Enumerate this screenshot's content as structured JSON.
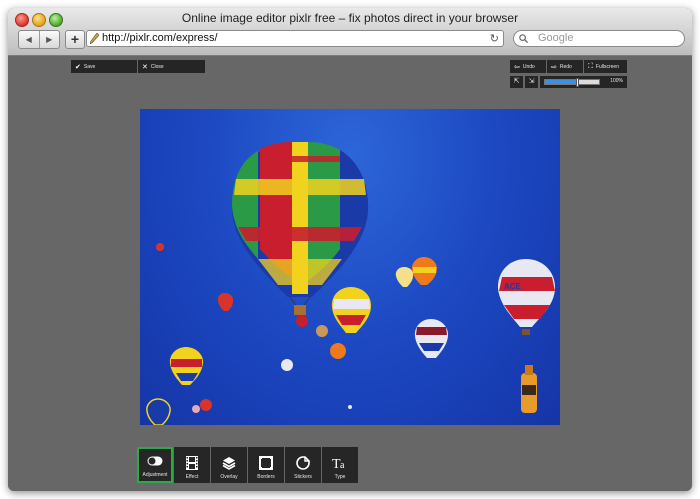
{
  "window": {
    "title": "Online image editor pixlr free – fix photos direct in your browser"
  },
  "browser": {
    "back_icon": "back-arrow-icon",
    "forward_icon": "forward-arrow-icon",
    "url": "http://pixlr.com/express/",
    "search_placeholder": "Google",
    "reload_icon": "reload-icon"
  },
  "editor": {
    "top_left": {
      "save_label": "Save",
      "close_label": "Close"
    },
    "top_right": {
      "undo_label": "Undo",
      "redo_label": "Redo",
      "fullscreen_label": "Fullscreen",
      "zoom_value": "100%",
      "zoom_level": 0.6
    },
    "image": {
      "subject": "hot-air-balloons-photo"
    },
    "tools": [
      {
        "label": "Adjustment",
        "icon": "toggle-icon",
        "active": true
      },
      {
        "label": "Effect",
        "icon": "film-icon",
        "active": false
      },
      {
        "label": "Overlay",
        "icon": "layers-icon",
        "active": false
      },
      {
        "label": "Borders",
        "icon": "frame-icon",
        "active": false
      },
      {
        "label": "Stickers",
        "icon": "sticker-icon",
        "active": false
      },
      {
        "label": "Type",
        "icon": "type-icon",
        "active": false
      }
    ]
  },
  "colors": {
    "accent_green": "#2fa84a",
    "zoom_blue": "#3f8fdf",
    "panel_dark": "#252525",
    "workspace_gray": "#676767",
    "sky_blue": "#1c48c2"
  }
}
